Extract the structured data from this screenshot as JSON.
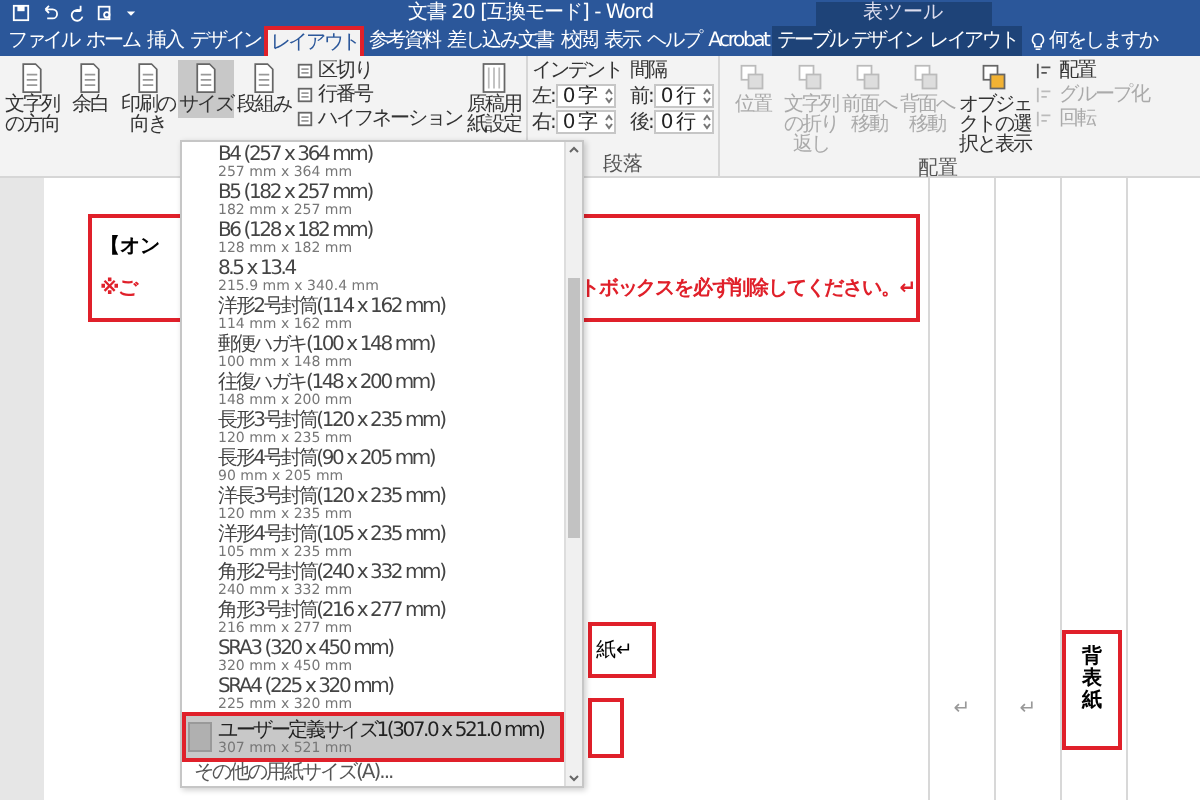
{
  "title_bar": {
    "title": "文書 20 [互換モード] - Word",
    "context_label": "表ツール"
  },
  "tabs": [
    {
      "label": "ファイル",
      "selected": false,
      "kind": "main"
    },
    {
      "label": "ホーム",
      "selected": false,
      "kind": "main"
    },
    {
      "label": "挿入",
      "selected": false,
      "kind": "main"
    },
    {
      "label": "デザイン",
      "selected": false,
      "kind": "main"
    },
    {
      "label": "レイアウト",
      "selected": true,
      "kind": "main"
    },
    {
      "label": "参考資料",
      "selected": false,
      "kind": "main"
    },
    {
      "label": "差し込み文書",
      "selected": false,
      "kind": "main"
    },
    {
      "label": "校閲",
      "selected": false,
      "kind": "main"
    },
    {
      "label": "表示",
      "selected": false,
      "kind": "main"
    },
    {
      "label": "ヘルプ",
      "selected": false,
      "kind": "main"
    },
    {
      "label": "Acrobat",
      "selected": false,
      "kind": "main"
    },
    {
      "label": "テーブル デザイン",
      "selected": false,
      "kind": "context"
    },
    {
      "label": "レイアウト",
      "selected": false,
      "kind": "context"
    }
  ],
  "tell_me": "何をしますか",
  "ribbon": {
    "page_setup": {
      "large": [
        {
          "label": "文字列の方向",
          "selected": false
        },
        {
          "label": "余白",
          "selected": false
        },
        {
          "label": "印刷の向き",
          "selected": false
        },
        {
          "label": "サイズ",
          "selected": true
        },
        {
          "label": "段組み",
          "selected": false
        }
      ],
      "small": [
        "区切り",
        "行番号",
        "ハイフネーション"
      ],
      "manuscript": "原稿用紙設定"
    },
    "paragraph": {
      "indent_label": "インデント",
      "spacing_label": "間隔",
      "indent": [
        {
          "label": "左:",
          "value": "0 字"
        },
        {
          "label": "右:",
          "value": "0 字"
        }
      ],
      "spacing": [
        {
          "label": "前:",
          "value": "0 行"
        },
        {
          "label": "後:",
          "value": "0 行"
        }
      ],
      "label": "段落"
    },
    "arrange": {
      "large": [
        {
          "label": "位置",
          "disabled": true
        },
        {
          "label": "文字列の折り返し",
          "disabled": true
        },
        {
          "label": "前面へ移動",
          "disabled": true
        },
        {
          "label": "背面へ移動",
          "disabled": true
        },
        {
          "label": "オブジェクトの選択と表示",
          "disabled": false
        }
      ],
      "small": [
        {
          "label": "配置",
          "disabled": false
        },
        {
          "label": "グループ化",
          "disabled": true
        },
        {
          "label": "回転",
          "disabled": true
        }
      ],
      "label": "配置"
    }
  },
  "size_menu": {
    "items": [
      {
        "title": "B4 (257 x 364 mm)",
        "size": "257 mm x 364 mm",
        "selected": false
      },
      {
        "title": "B5 (182 x 257 mm)",
        "size": "182 mm x 257 mm",
        "selected": false
      },
      {
        "title": "B6 (128 x 182 mm)",
        "size": "128 mm x 182 mm",
        "selected": false
      },
      {
        "title": "8.5 x 13.4",
        "size": "215.9 mm x 340.4 mm",
        "selected": false
      },
      {
        "title": "洋形2号封筒(114 x 162 mm)",
        "size": "114 mm x 162 mm",
        "selected": false
      },
      {
        "title": "郵便ハガキ(100 x 148 mm)",
        "size": "100 mm x 148 mm",
        "selected": false
      },
      {
        "title": "往復ハガキ(148 x 200 mm)",
        "size": "148 mm x 200 mm",
        "selected": false
      },
      {
        "title": "長形3号封筒(120 x 235 mm)",
        "size": "120 mm x 235 mm",
        "selected": false
      },
      {
        "title": "長形4号封筒(90 x 205 mm)",
        "size": "90 mm x 205 mm",
        "selected": false
      },
      {
        "title": "洋長3号封筒(120 x 235 mm)",
        "size": "120 mm x 235 mm",
        "selected": false
      },
      {
        "title": "洋形4号封筒(105 x 235 mm)",
        "size": "105 mm x 235 mm",
        "selected": false
      },
      {
        "title": "角形2号封筒(240 x 332 mm)",
        "size": "240 mm x 332 mm",
        "selected": false
      },
      {
        "title": "角形3号封筒(216 x 277 mm)",
        "size": "216 mm x 277 mm",
        "selected": false
      },
      {
        "title": "SRA3 (320 x 450 mm)",
        "size": "320 mm x 450 mm",
        "selected": false
      },
      {
        "title": "SRA4 (225 x 320 mm)",
        "size": "225 mm x 320 mm",
        "selected": false
      },
      {
        "title": "ユーザー定義サイズ1(307.0 x 521.0 mm)",
        "size": "307 mm x 521 mm",
        "selected": true
      }
    ],
    "more": "その他の用紙サイズ(A)..."
  },
  "document": {
    "notice": {
      "heading": "【オン",
      "warning_start": "※ご",
      "warning_end": "トボックスを必ず削除してください。↵"
    },
    "label_box": "紙↵",
    "column_marks": [
      "↵",
      "↵"
    ],
    "spine_label": "背表紙"
  }
}
